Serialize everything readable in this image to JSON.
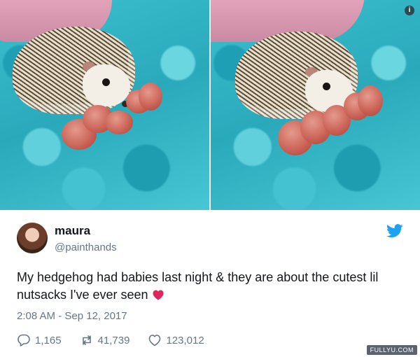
{
  "tweet": {
    "display_name": "maura",
    "handle": "@painthands",
    "text": "My hedgehog had babies last night & they are about the cutest lil nutsacks I've ever seen",
    "emoji": "heart",
    "timestamp": "2:08 AM - Sep 12, 2017",
    "replies": "1,165",
    "retweets": "41,739",
    "likes": "123,012"
  },
  "media": {
    "info_badge": "i"
  },
  "watermark": "FULLYU.COM",
  "icons": {
    "platform": "twitter-bird-icon",
    "reply": "reply-icon",
    "retweet": "retweet-icon",
    "like": "heart-icon"
  },
  "colors": {
    "brand_blue": "#1da1f2",
    "muted_text": "#657786",
    "heart_red": "#e0245e"
  }
}
